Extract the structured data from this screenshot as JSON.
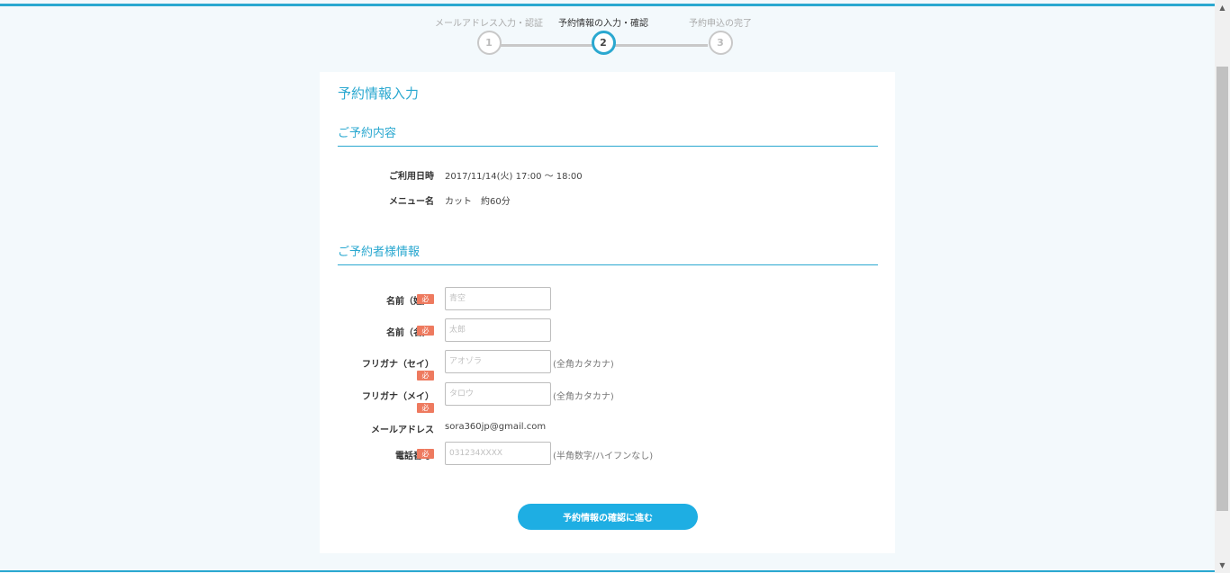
{
  "steps": [
    {
      "label": "メールアドレス入力・認証",
      "number": "1",
      "state": "done"
    },
    {
      "label": "予約情報の入力・確認",
      "number": "2",
      "state": "active"
    },
    {
      "label": "予約申込の完了",
      "number": "3",
      "state": "pending"
    }
  ],
  "form": {
    "title": "予約情報入力",
    "reservation_section": {
      "title": "ご予約内容",
      "date_label": "ご利用日時",
      "date_value": "2017/11/14(火) 17:00 〜 18:00",
      "menu_label": "メニュー名",
      "menu_value": "カット　約60分"
    },
    "customer_section": {
      "title": "ご予約者様情報",
      "required_badge": "必",
      "last_name_label": "名前（姓）",
      "last_name_placeholder": "青空",
      "first_name_label": "名前（名）",
      "first_name_placeholder": "太郎",
      "kana_last_label": "フリガナ（セイ）",
      "kana_last_placeholder": "アオゾラ",
      "kana_first_label": "フリガナ（メイ）",
      "kana_first_placeholder": "タロウ",
      "kana_hint": "(全角カタカナ)",
      "email_label": "メールアドレス",
      "email_value": "sora360jp@gmail.com",
      "phone_label": "電話番号",
      "phone_placeholder": "031234XXXX",
      "phone_hint": "(半角数字/ハイフンなし)"
    },
    "submit_label": "予約情報の確認に進む"
  },
  "colors": {
    "accent": "#2aa8d0",
    "badge": "#ee7a5f",
    "button": "#1eaee3"
  }
}
